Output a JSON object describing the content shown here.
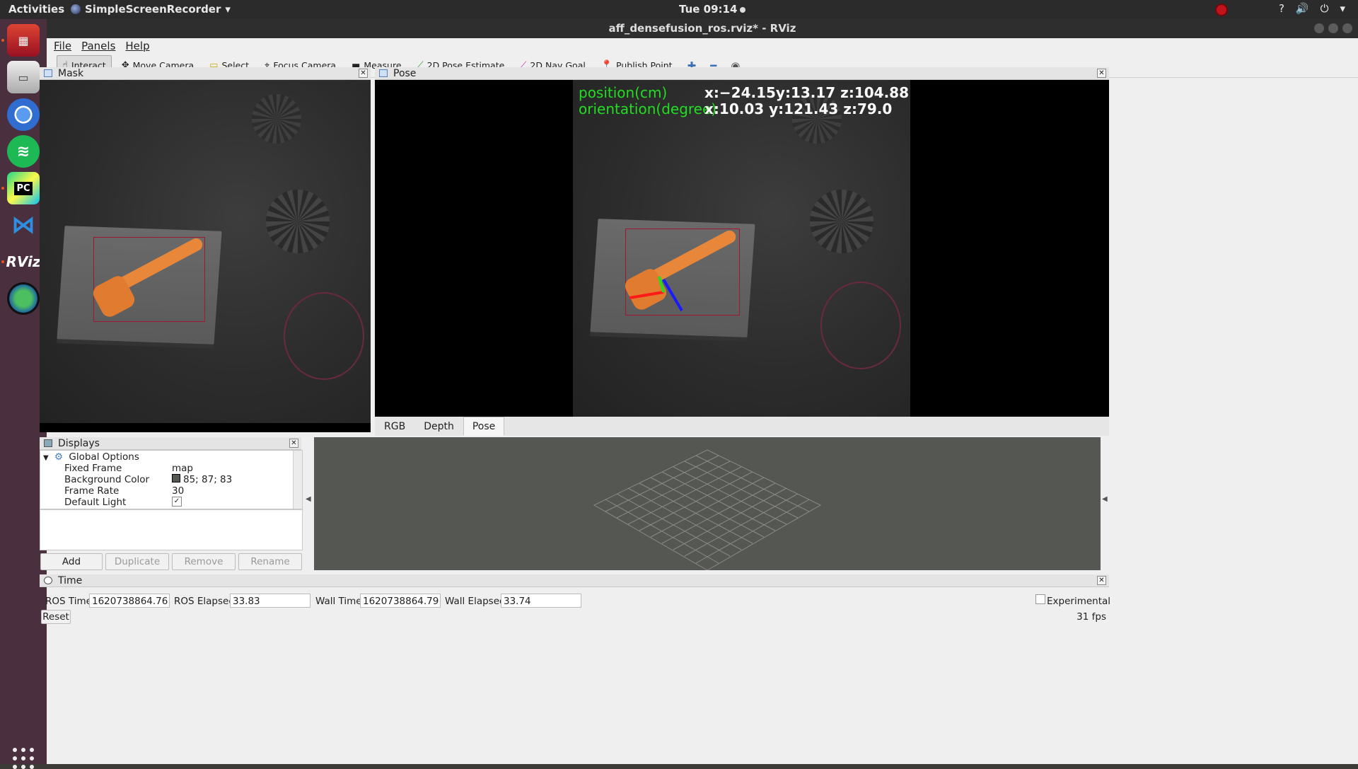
{
  "topbar": {
    "activities": "Activities",
    "app_menu": "SimpleScreenRecorder",
    "clock": "Tue 09:14",
    "tray": [
      "?",
      "🔊",
      "⏻",
      "▾"
    ]
  },
  "dock": {
    "items": [
      "screen-recorder",
      "files",
      "chromium",
      "spotify",
      "pycharm",
      "vscode",
      "rviz",
      "globe-app"
    ],
    "rviz_label": "RViz",
    "pycharm_label": "PC"
  },
  "window": {
    "title": "aff_densefusion_ros.rviz* - RViz",
    "menu": [
      "File",
      "Panels",
      "Help"
    ],
    "toolbar": [
      "Interact",
      "Move Camera",
      "Select",
      "Focus Camera",
      "Measure",
      "2D Pose Estimate",
      "2D Nav Goal",
      "Publish Point"
    ]
  },
  "panels": {
    "mask_title": "Mask",
    "pose_title": "Pose",
    "pose_overlay": {
      "position_label": "position(cm)",
      "position_values": "x:−24.15y:13.17   z:104.88",
      "orientation_label": "orientation(degree)",
      "orientation_values": "x:10.03   y:121.43 z:79.0"
    },
    "tabs": [
      "RGB",
      "Depth",
      "Pose"
    ],
    "selected_tab": "Pose"
  },
  "displays": {
    "title": "Displays",
    "global_options": "Global Options",
    "rows": [
      {
        "label": "Fixed Frame",
        "value": "map"
      },
      {
        "label": "Background Color",
        "value": "85; 87; 83"
      },
      {
        "label": "Frame Rate",
        "value": "30"
      },
      {
        "label": "Default Light",
        "value": "✓"
      }
    ],
    "bg_color_swatch": "#555753",
    "buttons": {
      "add": "Add",
      "duplicate": "Duplicate",
      "remove": "Remove",
      "rename": "Rename"
    }
  },
  "time": {
    "title": "Time",
    "ros_time_label": "ROS Time:",
    "ros_time": "1620738864.76",
    "ros_elapsed_label": "ROS Elapsed:",
    "ros_elapsed": "33.83",
    "wall_time_label": "Wall Time:",
    "wall_time": "1620738864.79",
    "wall_elapsed_label": "Wall Elapsed:",
    "wall_elapsed": "33.74",
    "experimental": "Experimental",
    "reset": "Reset",
    "fps": "31 fps"
  }
}
